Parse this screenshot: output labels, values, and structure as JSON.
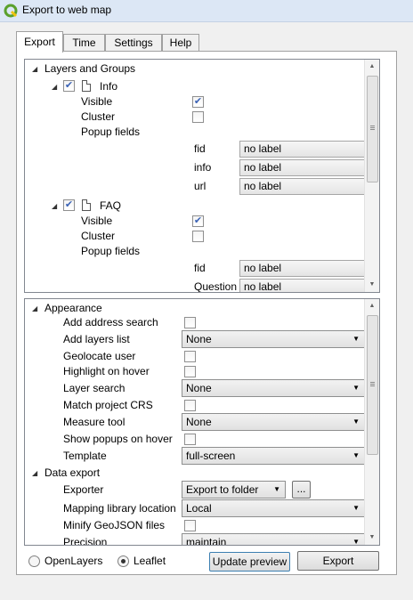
{
  "window": {
    "title": "Export to web map",
    "icon": "qgis-icon"
  },
  "tabs": [
    {
      "label": "Export",
      "active": true
    },
    {
      "label": "Time",
      "active": false
    },
    {
      "label": "Settings",
      "active": false
    },
    {
      "label": "Help",
      "active": false
    }
  ],
  "layers_panel": {
    "section_label": "Layers and Groups",
    "layers": [
      {
        "name": "Info",
        "checked": true,
        "visible_label": "Visible",
        "visible": true,
        "cluster_label": "Cluster",
        "cluster": false,
        "popup_label": "Popup fields",
        "fields": [
          {
            "name": "fid",
            "value": "no label"
          },
          {
            "name": "info",
            "value": "no label"
          },
          {
            "name": "url",
            "value": "no label"
          }
        ]
      },
      {
        "name": "FAQ",
        "checked": true,
        "visible_label": "Visible",
        "visible": true,
        "cluster_label": "Cluster",
        "cluster": false,
        "popup_label": "Popup fields",
        "fields": [
          {
            "name": "fid",
            "value": "no label"
          },
          {
            "name": "Question",
            "value": "no label"
          }
        ]
      }
    ]
  },
  "options_panel": {
    "appearance_label": "Appearance",
    "appearance": {
      "address_search": {
        "label": "Add address search",
        "checked": false
      },
      "layers_list": {
        "label": "Add layers list",
        "value": "None"
      },
      "geolocate": {
        "label": "Geolocate user",
        "checked": false
      },
      "highlight": {
        "label": "Highlight on hover",
        "checked": false
      },
      "layer_search": {
        "label": "Layer search",
        "value": "None"
      },
      "match_crs": {
        "label": "Match project CRS",
        "checked": false
      },
      "measure": {
        "label": "Measure tool",
        "value": "None"
      },
      "popups_hover": {
        "label": "Show popups on hover",
        "checked": false
      },
      "template": {
        "label": "Template",
        "value": "full-screen"
      }
    },
    "data_export_label": "Data export",
    "data_export": {
      "exporter": {
        "label": "Exporter",
        "value": "Export to folder",
        "browse": "..."
      },
      "mapping_lib": {
        "label": "Mapping library location",
        "value": "Local"
      },
      "minify": {
        "label": "Minify GeoJSON files",
        "checked": false
      },
      "precision": {
        "label": "Precision",
        "value": "maintain"
      }
    }
  },
  "footer": {
    "openlayers_label": "OpenLayers",
    "openlayers_selected": false,
    "leaflet_label": "Leaflet",
    "leaflet_selected": true,
    "update_label": "Update preview",
    "export_label": "Export"
  },
  "colors": {
    "titlebar": "#dce7f5",
    "dialog_bg": "#f0f0f0",
    "check": "#3a62b5"
  }
}
